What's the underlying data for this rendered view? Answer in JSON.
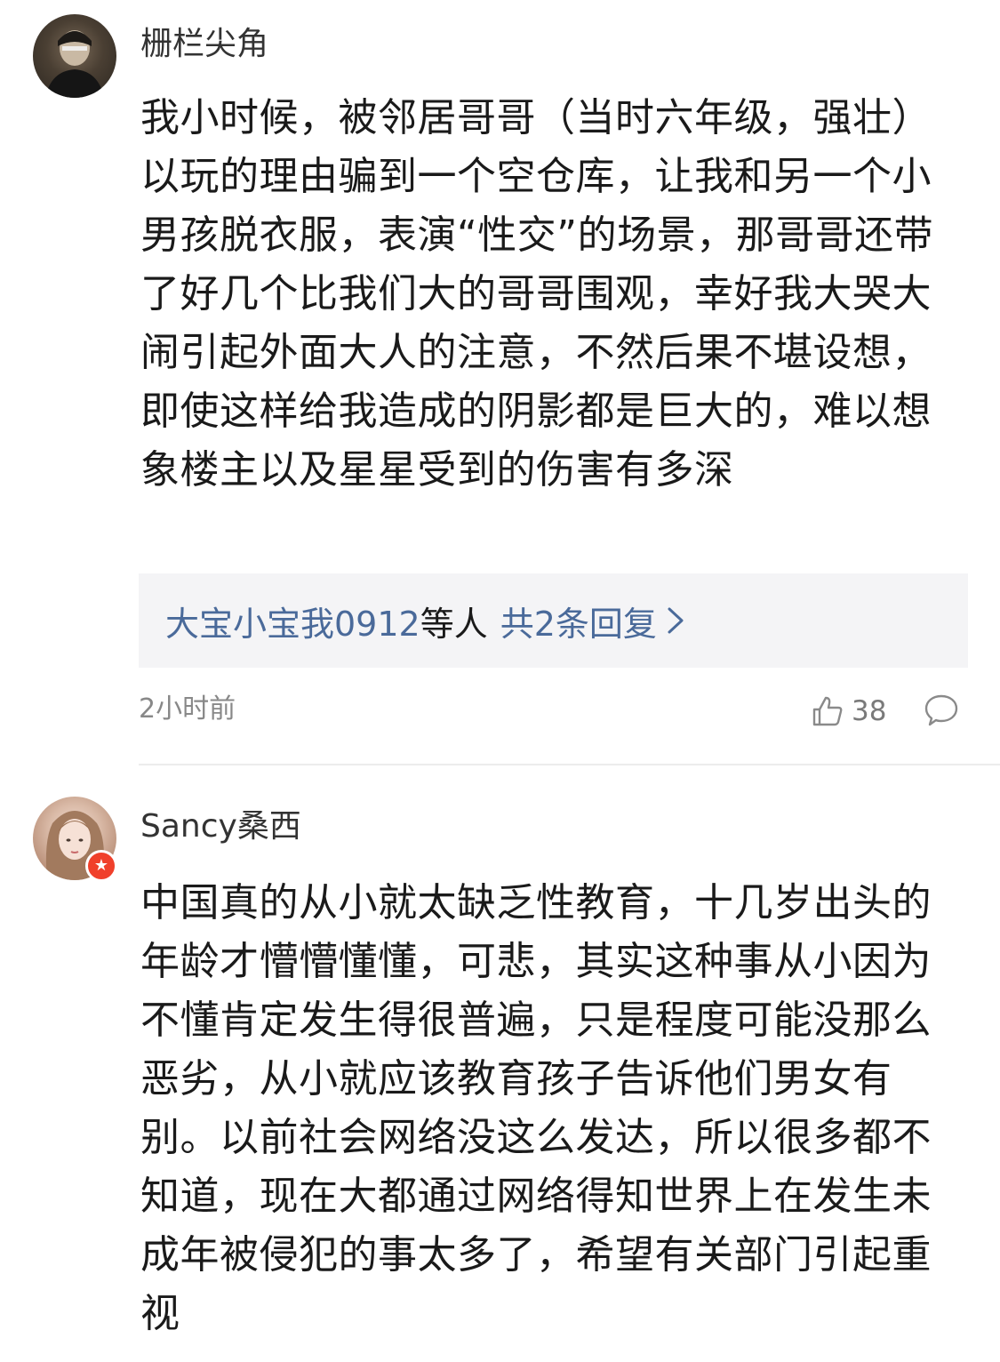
{
  "comments": [
    {
      "username": "栅栏尖角",
      "text": "我小时候，被邻居哥哥（当时六年级，强壮）以玩的理由骗到一个空仓库，让我和另一个小男孩脱衣服，表演“性交”的场景，那哥哥还带了好几个比我们大的哥哥围观，幸好我大哭大闹引起外面大人的注意，不然后果不堪设想，即使这样给我造成的阴影都是巨大的，难以想象楼主以及星星受到的伤害有多深",
      "replies": {
        "user_link": "大宝小宝我0912",
        "suffix": "等人",
        "count_label": "共2条回复"
      },
      "time": "2小时前",
      "likes": "38"
    },
    {
      "username": "Sancy桑西",
      "verified_badge": "star-badge",
      "text": "中国真的从小就太缺乏性教育，十几岁出头的年龄才懵懵懂懂，可悲，其实这种事从小因为不懂肯定发生得很普遍，只是程度可能没那么恶劣，从小就应该教育孩子告诉他们男女有别。以前社会网络没这么发达，所以很多都不知道，现在大都通过网络得知世界上在发生未成年被侵犯的事太多了，希望有关部门引起重视"
    }
  ],
  "colors": {
    "link": "#4a6a9a",
    "meta": "#888888",
    "reply_bg": "#f4f4f6",
    "badge": "#f0402b"
  }
}
